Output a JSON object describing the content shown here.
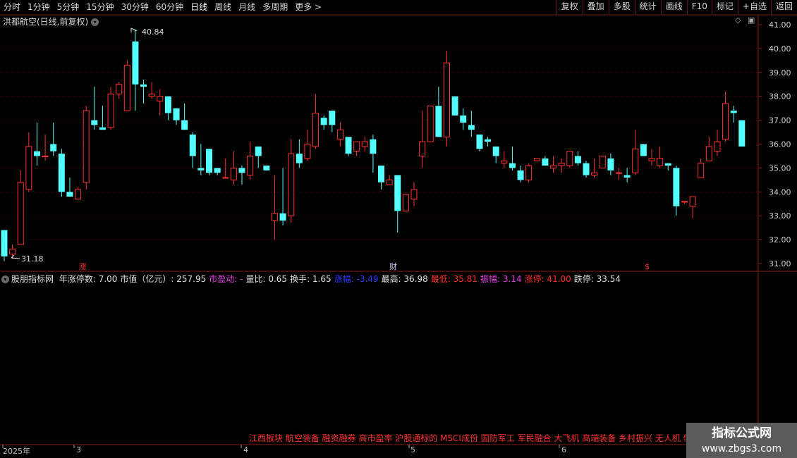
{
  "toolbar": {
    "periods": [
      "分时",
      "1分钟",
      "5分钟",
      "15分钟",
      "30分钟",
      "60分钟",
      "日线",
      "周线",
      "月线",
      "多周期",
      "更多 >"
    ],
    "right_buttons": [
      "复权",
      "叠加",
      "多股",
      "统计",
      "画线",
      "F10",
      "标记",
      "+自选",
      "返回"
    ]
  },
  "main_chart": {
    "title": "洪都航空(日线,前复权)",
    "max_label": "40.84",
    "min_label": "31.18",
    "markers": [
      "涨",
      "财",
      "$"
    ],
    "price_axis_labels": [
      "41.00",
      "40.00",
      "39.00",
      "38.00",
      "37.00",
      "36.00",
      "35.00",
      "34.00",
      "33.00",
      "32.00",
      "31.00"
    ]
  },
  "indicator_row": {
    "name": "股朋指标网",
    "items": [
      {
        "label": "年涨停数: 7.00",
        "color": "#e0e0e0"
      },
      {
        "label": "市值（亿元）: 257.95",
        "color": "#e0e0e0"
      },
      {
        "label": "市盈动: -",
        "color": "#e040e0"
      },
      {
        "label": "量比: 0.65",
        "color": "#e0e0e0"
      },
      {
        "label": "换手: 1.65",
        "color": "#e0e0e0"
      },
      {
        "label": "涨幅: -3.49",
        "color": "#2a3cff"
      },
      {
        "label": "最高: 36.98",
        "color": "#e0e0e0"
      },
      {
        "label": "最低: 35.81",
        "color": "#ff3030"
      },
      {
        "label": "振幅: 3.14",
        "color": "#e040e0"
      },
      {
        "label": "涨停: 41.00",
        "color": "#ff3030"
      },
      {
        "label": "跌停: 33.54",
        "color": "#e0e0e0"
      }
    ]
  },
  "sector_tags": "江西板块 航空装备 融资融券 高市盈率 沪股通标的 MSCI成份 国防军工 军民融合 大飞机 高端装备 乡村振兴 无人机 低",
  "dates": [
    "2025年",
    "3",
    "4",
    "5",
    "6"
  ],
  "watermark": {
    "line1": "指标公式网",
    "line2": "www.zbgs3.com"
  },
  "colors": {
    "up": "#ff3232",
    "down": "#54ffff",
    "frame": "#8b1a1a",
    "grid": "#7a1818"
  },
  "chart_data": {
    "type": "candlestick",
    "ylim": [
      30.8,
      41.3
    ],
    "ohlc": [
      [
        32.4,
        32.4,
        31.1,
        31.3
      ],
      [
        31.4,
        31.8,
        31.2,
        31.6
      ],
      [
        31.8,
        34.9,
        31.8,
        34.4
      ],
      [
        34.1,
        36.5,
        34.0,
        35.9
      ],
      [
        35.7,
        36.9,
        35.1,
        35.5
      ],
      [
        35.5,
        36.4,
        35.3,
        35.5
      ],
      [
        36.0,
        36.9,
        35.5,
        35.7
      ],
      [
        35.6,
        35.8,
        33.8,
        34.0
      ],
      [
        34.0,
        34.6,
        33.8,
        33.8
      ],
      [
        33.7,
        34.2,
        33.7,
        34.1
      ],
      [
        34.4,
        37.6,
        34.1,
        37.4
      ],
      [
        37.0,
        38.4,
        36.6,
        36.8
      ],
      [
        36.7,
        37.6,
        36.7,
        36.6
      ],
      [
        36.7,
        38.4,
        36.6,
        38.1
      ],
      [
        38.1,
        38.6,
        37.9,
        38.5
      ],
      [
        37.4,
        39.5,
        37.4,
        39.3
      ],
      [
        40.3,
        40.8,
        37.4,
        38.5
      ],
      [
        38.5,
        38.7,
        37.7,
        38.4
      ],
      [
        38.0,
        38.6,
        37.9,
        38.1
      ],
      [
        37.8,
        38.3,
        37.2,
        38.0
      ],
      [
        38.0,
        38.0,
        37.0,
        37.3
      ],
      [
        37.5,
        37.5,
        36.8,
        37.0
      ],
      [
        37.0,
        37.7,
        36.8,
        36.6
      ],
      [
        36.4,
        36.5,
        35.0,
        35.5
      ],
      [
        35.0,
        36.0,
        34.7,
        34.9
      ],
      [
        35.8,
        35.8,
        34.7,
        34.8
      ],
      [
        35.0,
        35.0,
        34.7,
        34.8
      ],
      [
        34.6,
        35.4,
        34.6,
        34.6
      ],
      [
        34.5,
        35.7,
        34.3,
        35.0
      ],
      [
        35.0,
        35.1,
        34.3,
        34.8
      ],
      [
        34.7,
        36.1,
        34.5,
        35.5
      ],
      [
        35.9,
        35.9,
        35.0,
        35.5
      ],
      [
        35.1,
        35.1,
        34.9,
        34.9
      ],
      [
        32.8,
        34.7,
        32.0,
        33.1
      ],
      [
        33.1,
        35.0,
        32.6,
        32.8
      ],
      [
        33.0,
        36.2,
        32.7,
        35.6
      ],
      [
        35.6,
        36.2,
        35.0,
        35.2
      ],
      [
        35.4,
        36.6,
        35.3,
        36.0
      ],
      [
        35.9,
        38.1,
        35.8,
        37.3
      ],
      [
        37.1,
        37.2,
        36.6,
        36.8
      ],
      [
        37.4,
        37.4,
        36.5,
        36.8
      ],
      [
        36.2,
        36.9,
        35.9,
        36.6
      ],
      [
        36.3,
        36.1,
        35.5,
        35.6
      ],
      [
        35.7,
        35.9,
        35.5,
        36.1
      ],
      [
        35.9,
        36.3,
        35.7,
        36.1
      ],
      [
        36.2,
        36.4,
        34.8,
        35.6
      ],
      [
        35.1,
        35.1,
        34.1,
        34.4
      ],
      [
        34.3,
        34.7,
        34.6,
        34.5
      ],
      [
        34.7,
        34.7,
        32.3,
        33.2
      ],
      [
        33.2,
        33.8,
        33.2,
        33.9
      ],
      [
        33.7,
        34.4,
        33.4,
        34.1
      ],
      [
        35.5,
        37.4,
        35.0,
        36.1
      ],
      [
        36.1,
        36.8,
        36.6,
        37.6
      ],
      [
        37.6,
        38.4,
        36.3,
        36.3
      ],
      [
        36.3,
        39.9,
        35.9,
        39.4
      ],
      [
        38.0,
        38.0,
        37.5,
        37.2
      ],
      [
        37.2,
        37.5,
        36.6,
        36.9
      ],
      [
        36.8,
        37.4,
        36.3,
        36.6
      ],
      [
        36.4,
        36.4,
        35.7,
        35.8
      ],
      [
        36.2,
        36.3,
        35.9,
        36.1
      ],
      [
        35.9,
        35.9,
        35.2,
        35.5
      ],
      [
        35.2,
        35.7,
        35.0,
        35.3
      ],
      [
        35.2,
        35.9,
        34.9,
        35.0
      ],
      [
        34.9,
        35.1,
        34.4,
        34.5
      ],
      [
        34.5,
        35.2,
        34.4,
        35.1
      ],
      [
        35.3,
        35.4,
        35.3,
        35.4
      ],
      [
        35.4,
        35.5,
        35.1,
        35.1
      ],
      [
        35.0,
        35.5,
        34.8,
        35.1
      ],
      [
        35.1,
        35.4,
        34.8,
        35.2
      ],
      [
        35.1,
        35.7,
        35.0,
        35.7
      ],
      [
        35.5,
        35.7,
        35.1,
        35.2
      ],
      [
        35.2,
        35.3,
        34.6,
        34.7
      ],
      [
        34.7,
        35.4,
        34.6,
        34.8
      ],
      [
        35.0,
        35.5,
        35.0,
        35.5
      ],
      [
        35.4,
        35.6,
        34.7,
        34.9
      ],
      [
        34.8,
        35.0,
        34.5,
        34.8
      ],
      [
        34.7,
        35.0,
        34.4,
        34.6
      ],
      [
        34.8,
        36.6,
        34.7,
        35.8
      ],
      [
        36.0,
        36.0,
        35.5,
        35.5
      ],
      [
        35.3,
        35.8,
        35.1,
        35.4
      ],
      [
        35.1,
        35.9,
        35.0,
        35.4
      ],
      [
        35.2,
        35.2,
        34.9,
        35.1
      ],
      [
        35.0,
        35.1,
        33.0,
        33.4
      ],
      [
        33.6,
        33.6,
        33.5,
        33.6
      ],
      [
        33.4,
        33.8,
        32.9,
        33.8
      ],
      [
        34.6,
        35.4,
        34.6,
        35.2
      ],
      [
        35.3,
        36.3,
        35.3,
        35.9
      ],
      [
        35.7,
        36.6,
        35.5,
        36.1
      ],
      [
        36.2,
        38.2,
        36.1,
        37.7
      ],
      [
        37.4,
        37.6,
        36.9,
        37.3
      ],
      [
        37.0,
        37.0,
        35.9,
        35.9
      ]
    ]
  }
}
